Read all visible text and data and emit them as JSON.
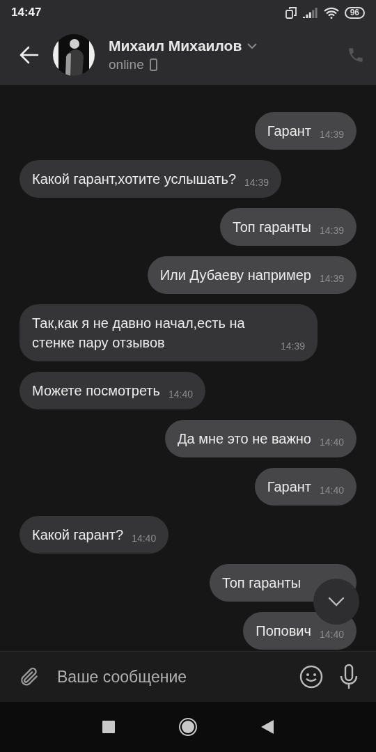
{
  "status_bar": {
    "time": "14:47",
    "battery": "96"
  },
  "header": {
    "name": "Михаил Михаилов",
    "presence": "online"
  },
  "messages": [
    {
      "outgoing": true,
      "text": "Гарант",
      "time": "14:39"
    },
    {
      "outgoing": false,
      "text": "Какой гарант,хотите услышать?",
      "time": "14:39"
    },
    {
      "outgoing": true,
      "text": "Топ гаранты",
      "time": "14:39"
    },
    {
      "outgoing": true,
      "text": "Или Дубаеву например",
      "time": "14:39"
    },
    {
      "outgoing": false,
      "text": "Так,как я не давно начал,есть на стенке пару отзывов",
      "time": "14:39"
    },
    {
      "outgoing": false,
      "text": "Можете посмотреть",
      "time": "14:40"
    },
    {
      "outgoing": true,
      "text": "Да мне это не важно",
      "time": "14:40"
    },
    {
      "outgoing": true,
      "text": "Гарант",
      "time": "14:40"
    },
    {
      "outgoing": false,
      "text": "Какой гарант?",
      "time": "14:40"
    },
    {
      "outgoing": true,
      "text": "Топ гаранты"
    },
    {
      "outgoing": true,
      "text": "Попович",
      "time": "14:40"
    }
  ],
  "composer": {
    "placeholder": "Ваше сообщение"
  }
}
